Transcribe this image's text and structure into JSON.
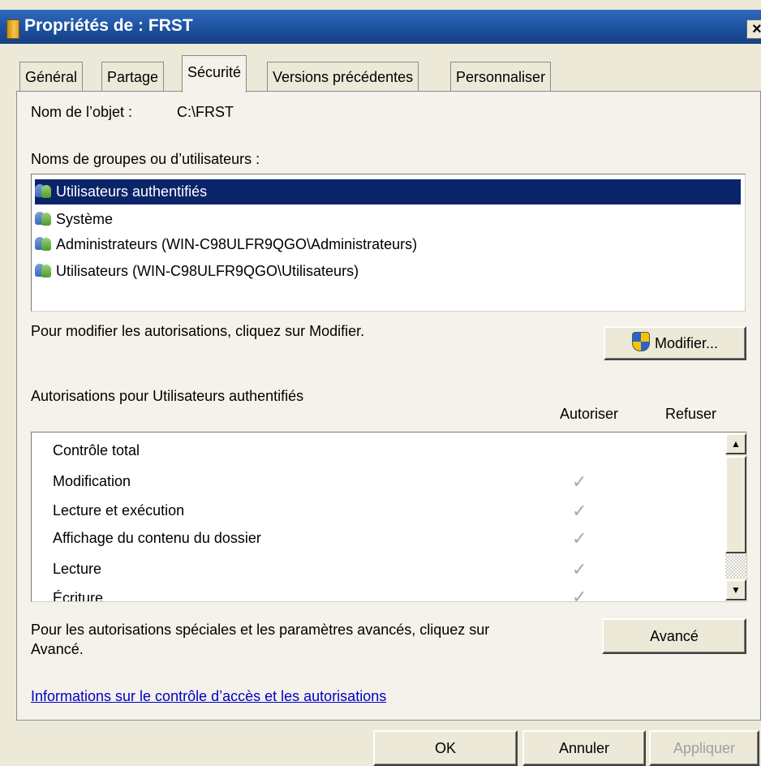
{
  "window": {
    "title": "Propriétés de : FRST",
    "close_glyph": "×"
  },
  "tabs": [
    {
      "label": "Général",
      "active": false
    },
    {
      "label": "Partage",
      "active": false
    },
    {
      "label": "Sécurité",
      "active": true
    },
    {
      "label": "Versions précédentes",
      "active": false
    },
    {
      "label": "Personnaliser",
      "active": false
    }
  ],
  "object": {
    "label": "Nom de l’objet :",
    "value": "C:\\FRST"
  },
  "groups": {
    "label": "Noms de groupes ou d’utilisateurs :",
    "items": [
      {
        "name": "Utilisateurs authentifiés",
        "selected": true,
        "icon": "users-icon"
      },
      {
        "name": "Système",
        "selected": false,
        "icon": "users-icon"
      },
      {
        "name": "Administrateurs (WIN-C98ULFR9QGO\\Administrateurs)",
        "selected": false,
        "icon": "users-icon"
      },
      {
        "name": "Utilisateurs (WIN-C98ULFR9QGO\\Utilisateurs)",
        "selected": false,
        "icon": "users-icon"
      }
    ]
  },
  "modify": {
    "hint": "Pour modifier les autorisations, cliquez sur Modifier.",
    "button": "Modifier...",
    "icon": "uac-shield-icon"
  },
  "permissions": {
    "title": "Autorisations pour Utilisateurs authentifiés",
    "col_allow": "Autoriser",
    "col_deny": "Refuser",
    "rows": [
      {
        "name": "Contrôle total",
        "allow": false,
        "deny": false
      },
      {
        "name": "Modification",
        "allow": true,
        "deny": false
      },
      {
        "name": "Lecture et exécution",
        "allow": true,
        "deny": false
      },
      {
        "name": "Affichage du contenu du dossier",
        "allow": true,
        "deny": false
      },
      {
        "name": "Lecture",
        "allow": true,
        "deny": false
      },
      {
        "name": "Écriture",
        "allow": true,
        "deny": false
      }
    ],
    "check_glyph": "✓",
    "scroll_up": "▲",
    "scroll_down": "▼"
  },
  "advanced": {
    "hint_line1": "Pour les autorisations spéciales et les paramètres avancés, cliquez sur",
    "hint_line2": "Avancé.",
    "button": "Avancé"
  },
  "link": "Informations sur le contrôle d’accès et les autorisations",
  "footer": {
    "ok": "OK",
    "cancel": "Annuler",
    "apply": "Appliquer"
  },
  "colors": {
    "titlebar": "#1c4f9c",
    "selection": "#0a246a",
    "link": "#0000c8",
    "disabled_text": "#a0a0a0"
  }
}
